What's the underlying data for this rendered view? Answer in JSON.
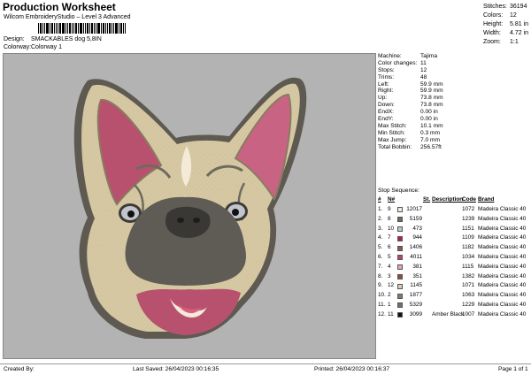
{
  "header": {
    "title": "Production Worksheet",
    "subtitle": "Wilcom EmbroideryStudio – Level 3 Advanced",
    "design_label": "Design:",
    "design_value": "SMACKABLES dog 5,8IN",
    "colorway_label": "Colorway:",
    "colorway_value": "Colorway 1"
  },
  "stats": [
    {
      "label": "Stitches:",
      "value": "36194"
    },
    {
      "label": "Colors:",
      "value": "12"
    },
    {
      "label": "Height:",
      "value": "5.81 in"
    },
    {
      "label": "Width:",
      "value": "4.72 in"
    },
    {
      "label": "Zoom:",
      "value": "1:1"
    }
  ],
  "machine_info": [
    {
      "label": "Machine:",
      "value": "Tajima"
    },
    {
      "label": "Color changes:",
      "value": "11"
    },
    {
      "label": "Stops:",
      "value": "12"
    },
    {
      "label": "Trims:",
      "value": "48"
    },
    {
      "label": "Left:",
      "value": "59.9 mm"
    },
    {
      "label": "Right:",
      "value": "59.9 mm"
    },
    {
      "label": "Up:",
      "value": "73.8 mm"
    },
    {
      "label": "Down:",
      "value": "73.8 mm"
    },
    {
      "label": "EndX:",
      "value": "0.00 in"
    },
    {
      "label": "EndY:",
      "value": "0.00 in"
    },
    {
      "label": "Max Stitch:",
      "value": "10.1 mm"
    },
    {
      "label": "Min Stitch:",
      "value": "0.3 mm"
    },
    {
      "label": "Max Jump:",
      "value": "7.0 mm"
    },
    {
      "label": "Total Bobbin:",
      "value": "256.57ft"
    }
  ],
  "sequence": {
    "title": "Stop Sequence:",
    "headers": {
      "stop": "#",
      "num": "N#",
      "st": "St.",
      "desc": "Description",
      "code": "Code",
      "brand": "Brand"
    },
    "rows": [
      {
        "stop": "1.",
        "num": "9",
        "color": "#f3ead8",
        "st": "12017",
        "desc": "",
        "code": "1072",
        "brand": "Madeira Classic 40"
      },
      {
        "stop": "2.",
        "num": "8",
        "color": "#6e6a62",
        "st": "5159",
        "desc": "",
        "code": "1239",
        "brand": "Madeira Classic 40"
      },
      {
        "stop": "3.",
        "num": "10",
        "color": "#c2c6cc",
        "st": "473",
        "desc": "",
        "code": "1151",
        "brand": "Madeira Classic 40"
      },
      {
        "stop": "4.",
        "num": "7",
        "color": "#b21f56",
        "st": "944",
        "desc": "",
        "code": "1109",
        "brand": "Madeira Classic 40"
      },
      {
        "stop": "5.",
        "num": "6",
        "color": "#8c5a4e",
        "st": "1406",
        "desc": "",
        "code": "1182",
        "brand": "Madeira Classic 40"
      },
      {
        "stop": "6.",
        "num": "5",
        "color": "#c2406e",
        "st": "4011",
        "desc": "",
        "code": "1034",
        "brand": "Madeira Classic 40"
      },
      {
        "stop": "7.",
        "num": "4",
        "color": "#e7a6b3",
        "st": "381",
        "desc": "",
        "code": "1115",
        "brand": "Madeira Classic 40"
      },
      {
        "stop": "8.",
        "num": "3",
        "color": "#8f4d40",
        "st": "351",
        "desc": "",
        "code": "1382",
        "brand": "Madeira Classic 40"
      },
      {
        "stop": "9.",
        "num": "12",
        "color": "#d8cdb4",
        "st": "1145",
        "desc": "",
        "code": "1071",
        "brand": "Madeira Classic 40"
      },
      {
        "stop": "10.",
        "num": "2",
        "color": "#8a7a62",
        "st": "1877",
        "desc": "",
        "code": "1063",
        "brand": "Madeira Classic 40"
      },
      {
        "stop": "11.",
        "num": "1",
        "color": "#6f7269",
        "st": "5329",
        "desc": "",
        "code": "1229",
        "brand": "Madeira Classic 40"
      },
      {
        "stop": "12.",
        "num": "11",
        "color": "#111111",
        "st": "3099",
        "desc": "Amber Black",
        "code": "1007",
        "brand": "Madeira Classic 40"
      }
    ]
  },
  "footer": {
    "created_by": "Created By:",
    "last_saved": "Last Saved: 26/04/2023 00:16:35",
    "printed": "Printed: 26/04/2023 00:16:37",
    "page": "Page 1 of 1"
  },
  "design_colors": {
    "background": "#b3b3b3",
    "fur": "#d6c9a4",
    "outline": "#5e5a52",
    "ear_inner": "#b8516d",
    "mouth": "#5f5b55",
    "tongue": "#d75e82"
  }
}
